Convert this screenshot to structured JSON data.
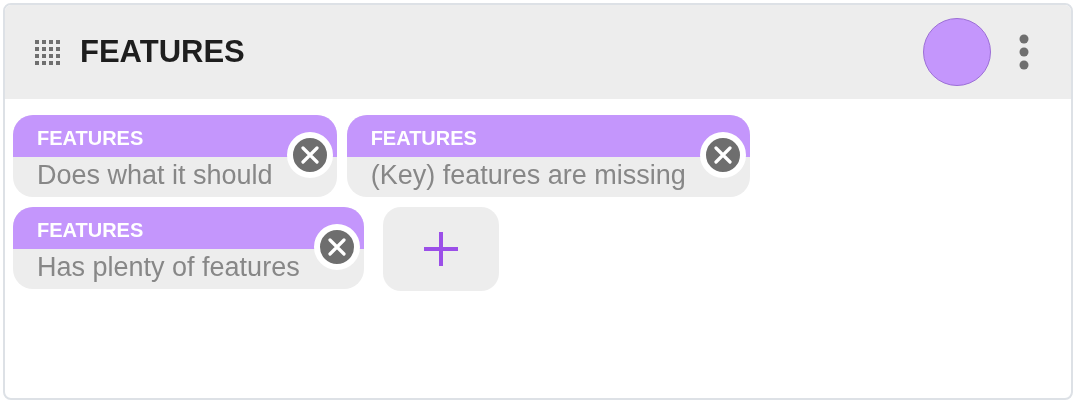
{
  "header": {
    "title": "FEATURES"
  },
  "tags": [
    {
      "category": "FEATURES",
      "value": "Does what it should"
    },
    {
      "category": "FEATURES",
      "value": "(Key) features are missing"
    },
    {
      "category": "FEATURES",
      "value": "Has plenty of features"
    }
  ]
}
